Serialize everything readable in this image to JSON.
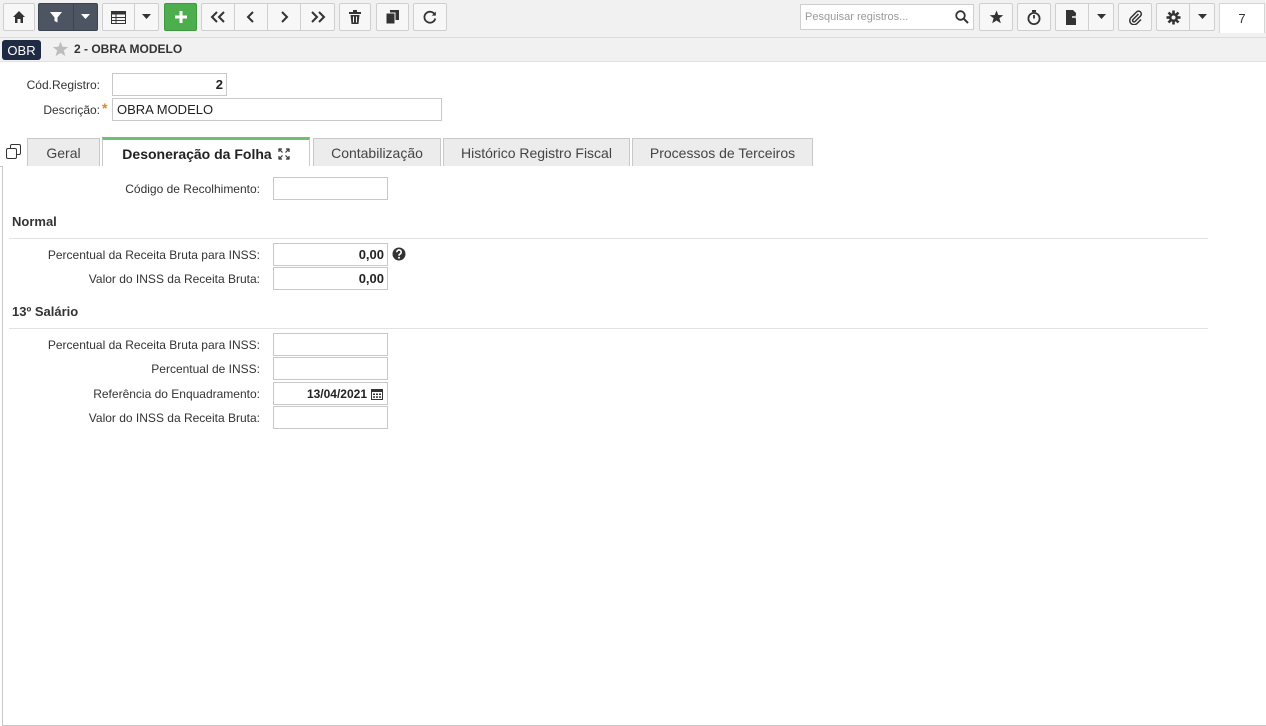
{
  "toolbar": {
    "search_placeholder": "Pesquisar registros...",
    "record_count": "7",
    "icons": [
      "home-icon",
      "filter-icon",
      "caret-down-icon",
      "table-icon",
      "caret-down-icon",
      "plus-icon",
      "first-icon",
      "prev-icon",
      "next-icon",
      "last-icon",
      "trash-icon",
      "copy-icon",
      "refresh-icon",
      "search-icon",
      "star-icon",
      "stopwatch-icon",
      "export-icon",
      "caret-down-icon",
      "attachment-icon",
      "gear-icon",
      "caret-down-icon"
    ]
  },
  "breadcrumb": {
    "module_code": "OBR",
    "title": "2 - OBRA MODELO"
  },
  "header": {
    "cod_registro_label": "Cód.Registro:",
    "cod_registro_value": "2",
    "descricao_label": "Descrição:",
    "descricao_value": "OBRA MODELO"
  },
  "tabs": [
    {
      "label": "Geral",
      "active": false
    },
    {
      "label": "Desoneração da Folha",
      "active": true
    },
    {
      "label": "Contabilização",
      "active": false
    },
    {
      "label": "Histórico Registro Fiscal",
      "active": false
    },
    {
      "label": "Processos de Terceiros",
      "active": false
    }
  ],
  "form": {
    "codigo_recolhimento_label": "Código de Recolhimento:",
    "codigo_recolhimento_value": "",
    "normal": {
      "title": "Normal",
      "percentual_label": "Percentual da Receita Bruta para INSS:",
      "percentual_value": "0,00",
      "valor_label": "Valor do INSS da Receita Bruta:",
      "valor_value": "0,00"
    },
    "salario13": {
      "title": "13º Salário",
      "percentual_receita_label": "Percentual da Receita Bruta para INSS:",
      "percentual_receita_value": "",
      "percentual_inss_label": "Percentual de INSS:",
      "percentual_inss_value": "",
      "referencia_label": "Referência do Enquadramento:",
      "referencia_value": "13/04/2021",
      "valor_label": "Valor do INSS da Receita Bruta:",
      "valor_value": ""
    }
  },
  "colors": {
    "toolbar_bg": "#f1f1f1",
    "dark_button": "#4d5562",
    "green_button": "#4cae4c",
    "active_tab_accent": "#6cc070",
    "badge_bg": "#1f2a44",
    "required_mark": "#e0862b"
  }
}
